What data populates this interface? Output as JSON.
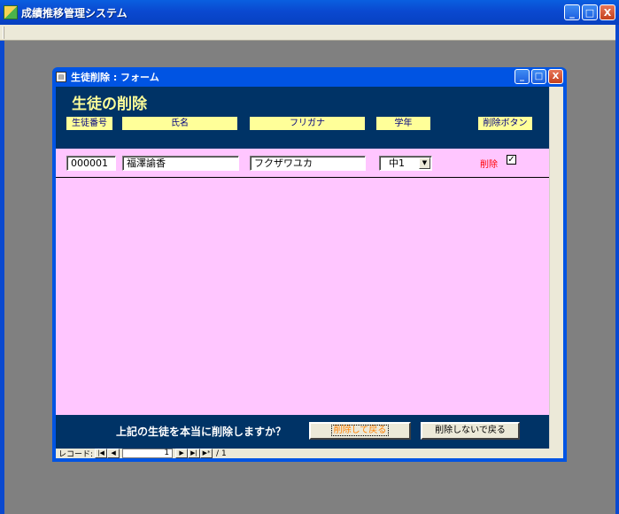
{
  "app": {
    "title": "成績推移管理システム",
    "window_buttons": {
      "minimize": "_",
      "maximize": "□",
      "close": "X"
    }
  },
  "form_window": {
    "title": "生徒削除 : フォーム",
    "window_buttons": {
      "minimize": "_",
      "maximize": "□",
      "close": "X"
    }
  },
  "form": {
    "heading": "生徒の削除",
    "columns": {
      "student_id": "生徒番号",
      "name": "氏名",
      "furigana": "フリガナ",
      "grade": "学年",
      "delete_button": "削除ボタン"
    },
    "record": {
      "student_id": "000001",
      "name": "福澤諭香",
      "furigana": "フクザワユカ",
      "grade": "中1",
      "delete_label": "削除",
      "delete_checked": true
    },
    "footer": {
      "message": "上記の生徒を本当に削除しますか？",
      "delete_and_back_label": "削除して戻る",
      "back_without_delete_label": "削除しないで戻る"
    }
  },
  "navigation": {
    "label": "レコード:",
    "current_record": "1",
    "total": "/ 1",
    "first_icon": "first-record-icon",
    "prev_icon": "prev-record-icon",
    "next_icon": "next-record-icon",
    "last_icon": "last-record-icon",
    "new_icon": "new-record-icon"
  }
}
